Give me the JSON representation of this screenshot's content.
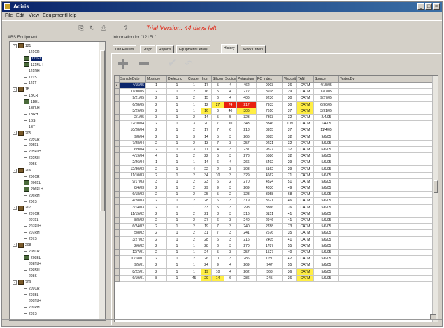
{
  "window": {
    "title": "Adiris"
  },
  "menu": [
    "File",
    "Edit",
    "View",
    "Equipment",
    "Help"
  ],
  "toolbar": {
    "icons": [
      "new-icon",
      "refresh-icon",
      "print-icon",
      "help-icon"
    ],
    "trial_text": "Trial Version. 44 days left."
  },
  "left_pane": {
    "label": "ABS Equipment",
    "tree": [
      {
        "label": "121",
        "level": 0,
        "icon": "folder",
        "expander": "-"
      },
      {
        "label": "121CR",
        "level": 2,
        "icon": "dot"
      },
      {
        "label": "121EL",
        "level": 2,
        "icon": "equip",
        "selected": true
      },
      {
        "label": "121FLH",
        "level": 2,
        "icon": "equip"
      },
      {
        "label": "121RH",
        "level": 2,
        "icon": "dot"
      },
      {
        "label": "121S",
        "level": 2,
        "icon": "dot"
      },
      {
        "label": "121T",
        "level": 2,
        "icon": "dot"
      },
      {
        "label": "1B",
        "level": 0,
        "icon": "folder",
        "expander": "-"
      },
      {
        "label": "1BCR",
        "level": 2,
        "icon": "dot"
      },
      {
        "label": "1BEL",
        "level": 2,
        "icon": "equip"
      },
      {
        "label": "1BFLH",
        "level": 2,
        "icon": "dot"
      },
      {
        "label": "1BRH",
        "level": 2,
        "icon": "dot"
      },
      {
        "label": "1BS",
        "level": 2,
        "icon": "dot"
      },
      {
        "label": "1BT",
        "level": 2,
        "icon": "dot"
      },
      {
        "label": "205",
        "level": 0,
        "icon": "folder",
        "expander": "-"
      },
      {
        "label": "205CR",
        "level": 2,
        "icon": "dot"
      },
      {
        "label": "205EL",
        "level": 2,
        "icon": "dot"
      },
      {
        "label": "205FLH",
        "level": 2,
        "icon": "dot"
      },
      {
        "label": "205RH",
        "level": 2,
        "icon": "dot"
      },
      {
        "label": "205S",
        "level": 2,
        "icon": "dot"
      },
      {
        "label": "206",
        "level": 0,
        "icon": "folder",
        "expander": "-"
      },
      {
        "label": "206CR",
        "level": 2,
        "icon": "dot"
      },
      {
        "label": "206EL",
        "level": 2,
        "icon": "equip"
      },
      {
        "label": "206FLH",
        "level": 2,
        "icon": "equip"
      },
      {
        "label": "206RH",
        "level": 2,
        "icon": "dot"
      },
      {
        "label": "206S",
        "level": 2,
        "icon": "dot"
      },
      {
        "label": "207",
        "level": 0,
        "icon": "folder",
        "expander": "-"
      },
      {
        "label": "207CR",
        "level": 2,
        "icon": "dot"
      },
      {
        "label": "207EL",
        "level": 2,
        "icon": "dot"
      },
      {
        "label": "207FLH",
        "level": 2,
        "icon": "dot"
      },
      {
        "label": "207RH",
        "level": 2,
        "icon": "dot"
      },
      {
        "label": "207S",
        "level": 2,
        "icon": "dot"
      },
      {
        "label": "208",
        "level": 0,
        "icon": "folder",
        "expander": "-"
      },
      {
        "label": "208CR",
        "level": 2,
        "icon": "dot"
      },
      {
        "label": "208EL",
        "level": 2,
        "icon": "equip"
      },
      {
        "label": "208FLH",
        "level": 2,
        "icon": "dot"
      },
      {
        "label": "208RH",
        "level": 2,
        "icon": "dot"
      },
      {
        "label": "208S",
        "level": 2,
        "icon": "dot"
      },
      {
        "label": "209",
        "level": 0,
        "icon": "folder",
        "expander": "-"
      },
      {
        "label": "209CR",
        "level": 2,
        "icon": "dot"
      },
      {
        "label": "209EL",
        "level": 2,
        "icon": "dot"
      },
      {
        "label": "209FLH",
        "level": 2,
        "icon": "dot"
      },
      {
        "label": "209RH",
        "level": 2,
        "icon": "dot"
      },
      {
        "label": "209S",
        "level": 2,
        "icon": "dot"
      }
    ]
  },
  "right_pane": {
    "label": "Information for \"121EL\"",
    "tabs": [
      "Lab Results",
      "Graph",
      "Reports",
      "Equipment Details",
      "History",
      "Work Orders"
    ],
    "active_tab": "History",
    "actions": [
      "add-icon",
      "remove-icon",
      "check-icon",
      "undo-icon"
    ]
  },
  "grid": {
    "columns": [
      "SampleDate",
      "Moisture",
      "Dielectric",
      "Copper",
      "Iron",
      "Silicon",
      "Sodium",
      "Potassium",
      "PQ Index",
      "Viscosity",
      "TAN",
      "Source",
      "TestedBy",
      "Comments"
    ],
    "rows": [
      [
        "4/15/05",
        "1",
        "1",
        "1",
        "17",
        "5",
        "4",
        "462",
        "9903",
        "36",
        "CATM",
        "4/15/05",
        ""
      ],
      [
        "11/30/05",
        "2",
        "1",
        "2",
        "16",
        "5",
        "4",
        "272",
        "8918",
        "29",
        "CATM",
        "12/7/05",
        ""
      ],
      [
        "9/21/05",
        "2",
        "1",
        "2",
        "15",
        "6",
        "4",
        "406",
        "9236",
        "30",
        "CATM",
        "9/27/05",
        ""
      ],
      [
        "6/28/05",
        "2",
        "1",
        "1",
        "12",
        "27",
        "74",
        "217",
        "7933",
        "30",
        "CATM",
        "6/30/05",
        ""
      ],
      [
        "3/29/05",
        "2",
        "1",
        "1",
        "16",
        "6",
        "40",
        "306",
        "7610",
        "37",
        "CATM",
        "3/31/05",
        ""
      ],
      [
        "2/1/05",
        "3",
        "1",
        "2",
        "14",
        "5",
        "5",
        "323",
        "7393",
        "32",
        "CATM",
        "2/4/05",
        ""
      ],
      [
        "12/10/04",
        "2",
        "1",
        "3",
        "20",
        "7",
        "10",
        "343",
        "8346",
        "109",
        "CATM",
        "1/4/05",
        ""
      ],
      [
        "10/28/04",
        "2",
        "1",
        "2",
        "17",
        "7",
        "6",
        "218",
        "8955",
        "37",
        "CATM",
        "11/4/05",
        ""
      ],
      [
        "9/8/04",
        "2",
        "1",
        "3",
        "14",
        "5",
        "3",
        "266",
        "8385",
        "32",
        "CATM",
        "9/6/05",
        ""
      ],
      [
        "7/28/04",
        "2",
        "1",
        "2",
        "13",
        "7",
        "3",
        "257",
        "9221",
        "32",
        "CATM",
        "8/6/05",
        ""
      ],
      [
        "6/9/04",
        "2",
        "1",
        "3",
        "11",
        "4",
        "3",
        "237",
        "9827",
        "32",
        "CATM",
        "6/6/05",
        ""
      ],
      [
        "4/19/04",
        "4",
        "1",
        "2",
        "22",
        "5",
        "3",
        "278",
        "5686",
        "32",
        "CATM",
        "5/6/05",
        ""
      ],
      [
        "2/26/04",
        "1",
        "1",
        "1",
        "14",
        "6",
        "4",
        "266",
        "5492",
        "29",
        "CATM",
        "5/6/05",
        ""
      ],
      [
        "12/30/03",
        "2",
        "1",
        "4",
        "22",
        "2",
        "3",
        "308",
        "5162",
        "29",
        "CATM",
        "5/6/05",
        ""
      ],
      [
        "11/10/03",
        "2",
        "1",
        "2",
        "34",
        "10",
        "3",
        "329",
        "4662",
        "71",
        "CATM",
        "5/6/05",
        ""
      ],
      [
        "9/17/03",
        "3",
        "1",
        "2",
        "23",
        "6",
        "2",
        "270",
        "4824",
        "51",
        "CATM",
        "5/6/05",
        ""
      ],
      [
        "8/4/03",
        "2",
        "1",
        "2",
        "29",
        "9",
        "3",
        "269",
        "4030",
        "49",
        "CATM",
        "5/6/05",
        ""
      ],
      [
        "6/18/03",
        "2",
        "1",
        "2",
        "25",
        "5",
        "2",
        "328",
        "3958",
        "68",
        "CATM",
        "5/6/05",
        ""
      ],
      [
        "4/28/03",
        "2",
        "1",
        "2",
        "28",
        "6",
        "3",
        "319",
        "3521",
        "46",
        "CATM",
        "5/6/05",
        ""
      ],
      [
        "3/14/03",
        "2",
        "1",
        "1",
        "33",
        "5",
        "3",
        "298",
        "3366",
        "76",
        "CATM",
        "5/6/05",
        ""
      ],
      [
        "11/15/02",
        "2",
        "1",
        "2",
        "21",
        "8",
        "3",
        "316",
        "3151",
        "41",
        "CATM",
        "5/6/05",
        ""
      ],
      [
        "8/8/02",
        "2",
        "1",
        "2",
        "27",
        "6",
        "3",
        "240",
        "2946",
        "41",
        "CATM",
        "5/6/05",
        ""
      ],
      [
        "6/24/02",
        "2",
        "1",
        "2",
        "19",
        "7",
        "3",
        "240",
        "2788",
        "73",
        "CATM",
        "5/6/05",
        ""
      ],
      [
        "5/8/02",
        "2",
        "1",
        "2",
        "31",
        "7",
        "3",
        "241",
        "2676",
        "35",
        "CATM",
        "5/6/05",
        ""
      ],
      [
        "3/27/02",
        "2",
        "1",
        "2",
        "28",
        "6",
        "3",
        "216",
        "2405",
        "41",
        "CATM",
        "5/6/05",
        ""
      ],
      [
        "2/6/02",
        "2",
        "1",
        "1",
        "28",
        "6",
        "3",
        "270",
        "1787",
        "55",
        "CATM",
        "5/6/05",
        ""
      ],
      [
        "12/7/01",
        "2",
        "1",
        "1",
        "24",
        "5",
        "3",
        "257",
        "1527",
        "40",
        "CATM",
        "5/6/05",
        ""
      ],
      [
        "10/18/01",
        "2",
        "1",
        "2",
        "26",
        "11",
        "3",
        "286",
        "1150",
        "42",
        "CATM",
        "5/6/05",
        ""
      ],
      [
        "9/5/01",
        "2",
        "1",
        "1",
        "24",
        "9",
        "4",
        "269",
        "947",
        "55",
        "CATM",
        "5/6/05",
        ""
      ],
      [
        "8/22/01",
        "2",
        "1",
        "1",
        "19",
        "10",
        "4",
        "262",
        "563",
        "36",
        "CATM",
        "5/6/05",
        ""
      ],
      [
        "6/19/01",
        "8",
        "1",
        "45",
        "29",
        "14",
        "6",
        "286",
        "245",
        "36",
        "CATM",
        "5/6/05",
        ""
      ]
    ],
    "highlights": [
      {
        "row": 3,
        "col": 5,
        "color": "#ffee44"
      },
      {
        "row": 3,
        "col": 6,
        "color": "#e82010"
      },
      {
        "row": 3,
        "col": 7,
        "color": "#e82010"
      },
      {
        "row": 3,
        "col": 10,
        "color": "#ffee44"
      },
      {
        "row": 4,
        "col": 4,
        "color": "#ffee44"
      },
      {
        "row": 4,
        "col": 7,
        "color": "#ffee44"
      },
      {
        "row": 4,
        "col": 10,
        "color": "#ffee44"
      },
      {
        "row": 29,
        "col": 4,
        "color": "#ffee44"
      },
      {
        "row": 29,
        "col": 10,
        "color": "#ffee44"
      },
      {
        "row": 30,
        "col": 4,
        "color": "#ffee44"
      },
      {
        "row": 30,
        "col": 5,
        "color": "#ffee44"
      },
      {
        "row": 30,
        "col": 10,
        "color": "#ffee44"
      }
    ]
  },
  "colors": {
    "title_bar": "#0a246a",
    "trial_text": "#e02010",
    "selection": "#0a246a",
    "highlight_warning": "#ffee44",
    "highlight_alarm": "#e82010"
  }
}
